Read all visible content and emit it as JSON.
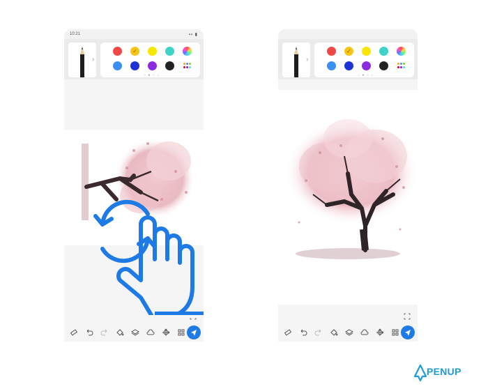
{
  "left_phone": {
    "status_time": "10:21",
    "status_icons": "▪▪ ▮",
    "pager": "○ ● ○ ○",
    "palette": [
      {
        "color": "#f04848",
        "name": "red",
        "selected": false
      },
      {
        "color": "#f5c518",
        "name": "yellow",
        "selected": true
      },
      {
        "color": "#f7e600",
        "name": "bright-yellow",
        "selected": false
      },
      {
        "color": "#3ed3c8",
        "name": "teal",
        "selected": false
      },
      {
        "color": "rainbow",
        "name": "color-wheel",
        "selected": false
      },
      {
        "color": "#3a8ff0",
        "name": "blue",
        "selected": false
      },
      {
        "color": "#1c34d6",
        "name": "dark-blue",
        "selected": false
      },
      {
        "color": "#8a2be2",
        "name": "purple",
        "selected": false
      },
      {
        "color": "#222222",
        "name": "black",
        "selected": false
      }
    ]
  },
  "right_phone": {
    "pager": "○ ● ○ ○"
  },
  "icons": {
    "tools": [
      "eraser-icon",
      "undo-icon",
      "redo-icon",
      "fill-icon",
      "layers-icon",
      "cloud-icon",
      "transform-icon",
      "grid-icon"
    ],
    "send": "send-icon",
    "expand": "expand-icon",
    "gesture": "rotate-hand-gesture-icon"
  },
  "colors": {
    "accent": "#1e7ae5",
    "logo": "#1e9bd7"
  },
  "logo": {
    "text": "PENUP"
  }
}
